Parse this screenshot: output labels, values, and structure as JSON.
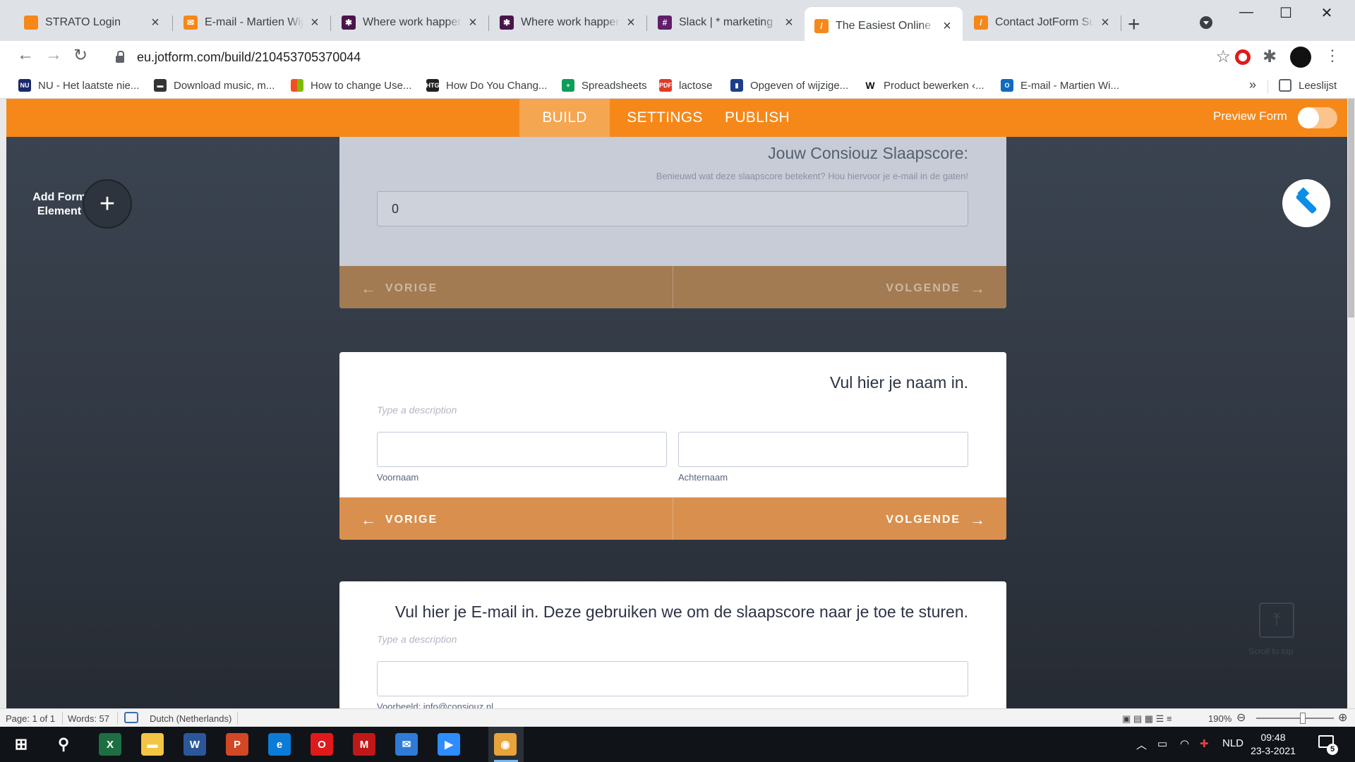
{
  "browser": {
    "tabs": [
      {
        "title": "STRATO Login",
        "icon": "strato-icon",
        "color": "#f68819",
        "glyph": ""
      },
      {
        "title": "E-mail - Martien Wijnands - Outlook",
        "icon": "mail-icon",
        "color": "#f68819",
        "glyph": "✉"
      },
      {
        "title": "Where work happens | Slack",
        "icon": "slack-icon",
        "color": "#4a154b",
        "glyph": "✱"
      },
      {
        "title": "Where work happens | Slack",
        "icon": "slack-icon",
        "color": "#4a154b",
        "glyph": "✱"
      },
      {
        "title": "Slack | * marketing | Consiouz",
        "icon": "slack-icon",
        "color": "#611f69",
        "glyph": "#"
      },
      {
        "title": "The Easiest Online Form Builder",
        "icon": "jotform-icon",
        "color": "#f68819",
        "glyph": "/"
      },
      {
        "title": "Contact JotForm Support",
        "icon": "jotform-icon",
        "color": "#f68819",
        "glyph": "/"
      }
    ],
    "url": "eu.jotform.com/build/210453705370044",
    "bookmarks": [
      {
        "label": "NU - Het laatste nie...",
        "color": "#1b2a6b",
        "glyph": "NU"
      },
      {
        "label": "Download music, m...",
        "color": "#333333",
        "glyph": "▬"
      },
      {
        "label": "How to change Use...",
        "color": "#f25022",
        "glyph": ""
      },
      {
        "label": "How Do You Chang...",
        "color": "#222222",
        "glyph": "HTG"
      },
      {
        "label": "Spreadsheets",
        "color": "#0f9d58",
        "glyph": "+"
      },
      {
        "label": "lactose",
        "color": "#e03a2a",
        "glyph": "PDF"
      },
      {
        "label": "Opgeven of wijzige...",
        "color": "#1c3f8c",
        "glyph": "▮"
      },
      {
        "label": "Product bewerken ‹...",
        "color": "#ffffff",
        "glyph": "W"
      },
      {
        "label": "E-mail - Martien Wi...",
        "color": "#0f6cbd",
        "glyph": "O"
      }
    ],
    "more": "»",
    "reading_list": "Leeslijst"
  },
  "jotform": {
    "nav": [
      "BUILD",
      "SETTINGS",
      "PUBLISH"
    ],
    "preview_label": "Preview Form",
    "add_element": "Add Form Element",
    "score_card": {
      "label": "Jouw Consiouz Slaapscore:",
      "sublabel": "Benieuwd wat deze slaapscore betekent? Hou hiervoor je e-mail in de gaten!",
      "value": "0",
      "prev": "VORIGE",
      "next": "VOLGENDE"
    },
    "name_card": {
      "label": "Vul hier je naam in.",
      "description_placeholder": "Type a description",
      "first_label": "Voornaam",
      "last_label": "Achternaam",
      "prev": "VORIGE",
      "next": "VOLGENDE"
    },
    "email_card": {
      "label": "Vul hier je E-mail in. Deze gebruiken we om de slaapscore naar je toe te sturen.",
      "description_placeholder": "Type a description",
      "example": "Voorbeeld: info@consiouz.nl"
    },
    "scroll_top": "Scroll to top",
    "accent": "#f68819"
  },
  "word_status": {
    "page": "Page: 1 of 1",
    "words": "Words: 57",
    "language": "Dutch (Netherlands)",
    "zoom": "190%"
  },
  "taskbar": {
    "apps": [
      {
        "name": "excel-icon",
        "color": "#1d6f42",
        "glyph": "X"
      },
      {
        "name": "file-explorer-icon",
        "color": "#f4c542",
        "glyph": "▬"
      },
      {
        "name": "word-icon",
        "color": "#2b579a",
        "glyph": "W"
      },
      {
        "name": "powerpoint-icon",
        "color": "#d24726",
        "glyph": "P"
      },
      {
        "name": "edge-icon",
        "color": "#0c7bd6",
        "glyph": "e"
      },
      {
        "name": "opera-icon",
        "color": "#e01a1a",
        "glyph": "O"
      },
      {
        "name": "mcafee-icon",
        "color": "#c01818",
        "glyph": "M"
      },
      {
        "name": "mail-icon",
        "color": "#2f7bd6",
        "glyph": "✉"
      },
      {
        "name": "zoom-icon",
        "color": "#2d8cff",
        "glyph": "▶"
      },
      {
        "name": "chrome-icon",
        "color": "#e8a33a",
        "glyph": "◉"
      }
    ],
    "language": "NLD",
    "time": "09:48",
    "date": "23-3-2021",
    "notifications": "5"
  }
}
